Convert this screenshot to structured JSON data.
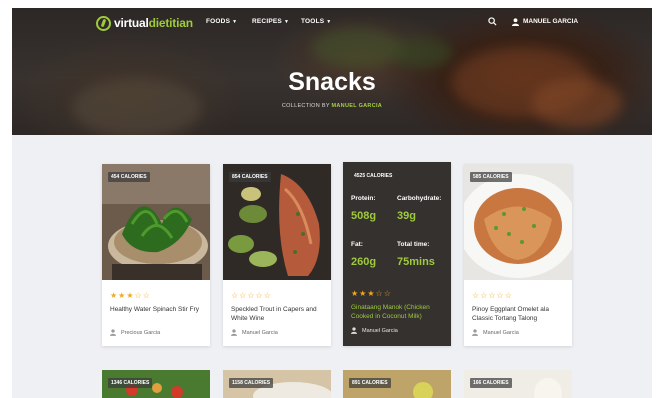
{
  "nav": {
    "logo_part1": "virtual",
    "logo_part2": "dietitian",
    "items": [
      "FOODS",
      "RECIPES",
      "TOOLS"
    ],
    "user": "MANUEL GARCIA"
  },
  "hero": {
    "title": "Snacks",
    "subtitle_prefix": "COLLECTION BY",
    "subtitle_author": "MANUEL GARCIA"
  },
  "cards": [
    {
      "calories": "454 CALORIES",
      "rating": 3,
      "stars": "★★★☆☆",
      "title": "Healthy Water Spinach Stir Fry",
      "author": "Precious Garcia"
    },
    {
      "calories": "854 CALORIES",
      "rating": 0,
      "stars": "☆☆☆☆☆",
      "title": "Speckled Trout in Capers and White Wine",
      "author": "Manuel Garcia"
    },
    {
      "calories": "4525 CALORIES",
      "rating": 3,
      "stars": "★★★☆☆",
      "title": "Ginataang Manok (Chicken Cooked in Coconut Milk)",
      "author": "Manuel Garcia",
      "nutrition": {
        "protein_label": "Protein:",
        "protein": "508g",
        "carb_label": "Carbohydrate:",
        "carb": "39g",
        "fat_label": "Fat:",
        "fat": "260g",
        "time_label": "Total time:",
        "time": "75mins"
      }
    },
    {
      "calories": "585 CALORIES",
      "rating": 0,
      "stars": "☆☆☆☆☆",
      "title": "Pinoy Eggplant Omelet ala Classic Tortang Talong",
      "author": "Manuel Garcia"
    }
  ],
  "next_row": [
    "1346 CALORIES",
    "1158 CALORIES",
    "891 CALORIES",
    "166 CALORIES"
  ],
  "colors": {
    "accent": "#9fcb3b",
    "star": "#f2a81d",
    "dark_card": "#34312f"
  }
}
